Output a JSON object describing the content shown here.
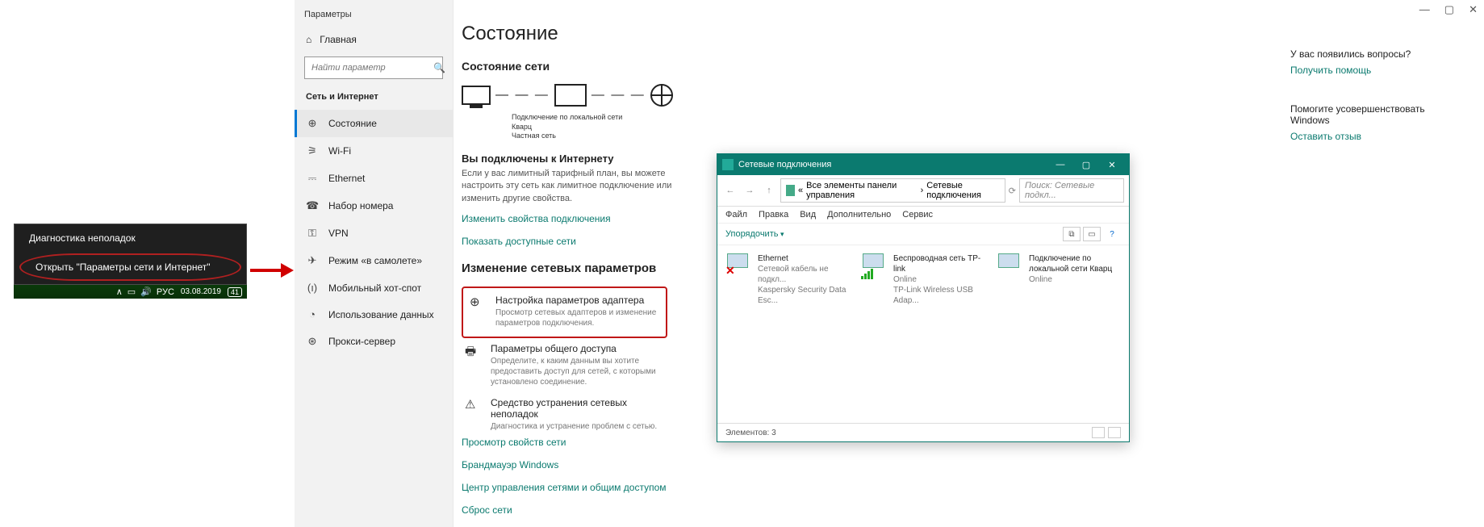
{
  "taskbar": {
    "diag": "Диагностика неполадок",
    "open": "Открыть \"Параметры сети и Интернет\"",
    "lang": "РУС",
    "date": "03.08.2019",
    "net_badge": "41"
  },
  "settings": {
    "app_title": "Параметры",
    "home": "Главная",
    "search_placeholder": "Найти параметр",
    "section": "Сеть и Интернет",
    "nav": [
      {
        "label": "Состояние"
      },
      {
        "label": "Wi-Fi"
      },
      {
        "label": "Ethernet"
      },
      {
        "label": "Набор номера"
      },
      {
        "label": "VPN"
      },
      {
        "label": "Режим «в самолете»"
      },
      {
        "label": "Мобильный хот-спот"
      },
      {
        "label": "Использование данных"
      },
      {
        "label": "Прокси-сервер"
      }
    ],
    "main_title": "Состояние",
    "net_status_title": "Состояние сети",
    "diag_line1": "Подключение по локальной сети",
    "diag_line2": "Кварц",
    "diag_line3": "Частная сеть",
    "connected_title": "Вы подключены к Интернету",
    "connected_body": "Если у вас лимитный тарифный план, вы можете настроить эту сеть как лимитное подключение или изменить другие свойства.",
    "link_props": "Изменить свойства подключения",
    "link_show": "Показать доступные сети",
    "change_title": "Изменение сетевых параметров",
    "opt_adapter_t": "Настройка параметров адаптера",
    "opt_adapter_d": "Просмотр сетевых адаптеров и изменение параметров подключения.",
    "opt_share_t": "Параметры общего доступа",
    "opt_share_d": "Определите, к каким данным вы хотите предоставить доступ для сетей, с которыми установлено соединение.",
    "opt_trouble_t": "Средство устранения сетевых неполадок",
    "opt_trouble_d": "Диагностика и устранение проблем с сетью.",
    "link_netprops": "Просмотр свойств сети",
    "link_firewall": "Брандмауэр Windows",
    "link_center": "Центр управления сетями и общим доступом",
    "link_reset": "Сброс сети",
    "help_q": "У вас появились вопросы?",
    "help_link": "Получить помощь",
    "improve_t": "Помогите усовершенствовать Windows",
    "improve_link": "Оставить отзыв"
  },
  "ncwin": {
    "title": "Сетевые подключения",
    "crumb1": "Все элементы панели управления",
    "crumb2": "Сетевые подключения",
    "search_ph": "Поиск: Сетевые подкл...",
    "menu": [
      "Файл",
      "Правка",
      "Вид",
      "Дополнительно",
      "Сервис"
    ],
    "organize": "Упорядочить",
    "conns": [
      {
        "name": "Ethernet",
        "status": "Сетевой кабель не подкл...",
        "detail": "Kaspersky Security Data Esc...",
        "x": true
      },
      {
        "name": "Беспроводная сеть TP-link",
        "status": "Online",
        "detail": "TP-Link Wireless USB Adap...",
        "bars": true
      },
      {
        "name": "Подключение по локальной сети Кварц",
        "status": "Online",
        "detail": ""
      }
    ],
    "status": "Элементов: 3"
  }
}
